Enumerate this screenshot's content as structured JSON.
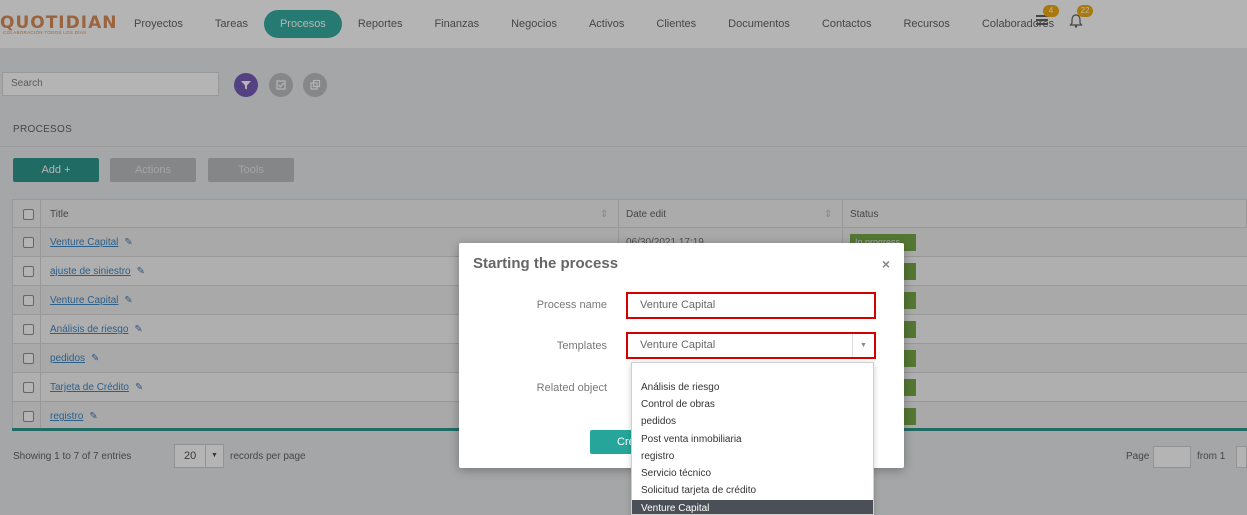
{
  "logo": {
    "word": "QUOTIDIAN",
    "tagline": "COLABORACIÓN TODOS LOS DÍAS"
  },
  "nav": [
    {
      "label": "Proyectos"
    },
    {
      "label": "Tareas"
    },
    {
      "label": "Procesos",
      "active": true
    },
    {
      "label": "Reportes"
    },
    {
      "label": "Finanzas"
    },
    {
      "label": "Negocios"
    },
    {
      "label": "Activos"
    },
    {
      "label": "Clientes"
    },
    {
      "label": "Documentos"
    },
    {
      "label": "Contactos"
    },
    {
      "label": "Recursos"
    },
    {
      "label": "Colaboradores"
    }
  ],
  "badges": {
    "list_count": "4",
    "bell_count": "22"
  },
  "search": {
    "placeholder": "Search"
  },
  "section_title": "PROCESOS",
  "buttons": {
    "add": "Add +",
    "actions": "Actions",
    "tools": "Tools"
  },
  "table": {
    "headers": {
      "title": "Title",
      "date_edit": "Date edit",
      "status": "Status"
    },
    "rows": [
      {
        "title": "Venture Capital",
        "date": "06/30/2021 17:19",
        "status": "In progress"
      },
      {
        "title": "ajuste de siniestro",
        "date": "",
        "status": ""
      },
      {
        "title": "Venture Capital",
        "date": "",
        "status": ""
      },
      {
        "title": "Análisis de riesgo",
        "date": "",
        "status": ""
      },
      {
        "title": "pedidos",
        "date": "",
        "status": ""
      },
      {
        "title": "Tarjeta de Crédito",
        "date": "",
        "status": ""
      },
      {
        "title": "registro",
        "date": "",
        "status": ""
      }
    ]
  },
  "footer": {
    "showing": "Showing 1 to 7 of 7 entries",
    "rpp_value": "20",
    "rpp_label": "records per page",
    "page_label": "Page",
    "from_label": "from 1"
  },
  "modal": {
    "title": "Starting the process",
    "close": "×",
    "process_name_label": "Process name",
    "process_name_value": "Venture Capital",
    "templates_label": "Templates",
    "templates_value": "Venture Capital",
    "related_label": "Related object",
    "create_label": "Create"
  },
  "dropdown_options": [
    "Análisis de riesgo",
    "Control de obras",
    "pedidos",
    "Post venta inmobiliaria",
    "registro",
    "Servicio técnico",
    "Solicitud tarjeta de crédito",
    "Venture Capital"
  ],
  "colors": {
    "accent": "#26a69a",
    "status_green": "#6ca33a",
    "highlight_red": "#d40000",
    "brand_orange": "#d9834a"
  }
}
